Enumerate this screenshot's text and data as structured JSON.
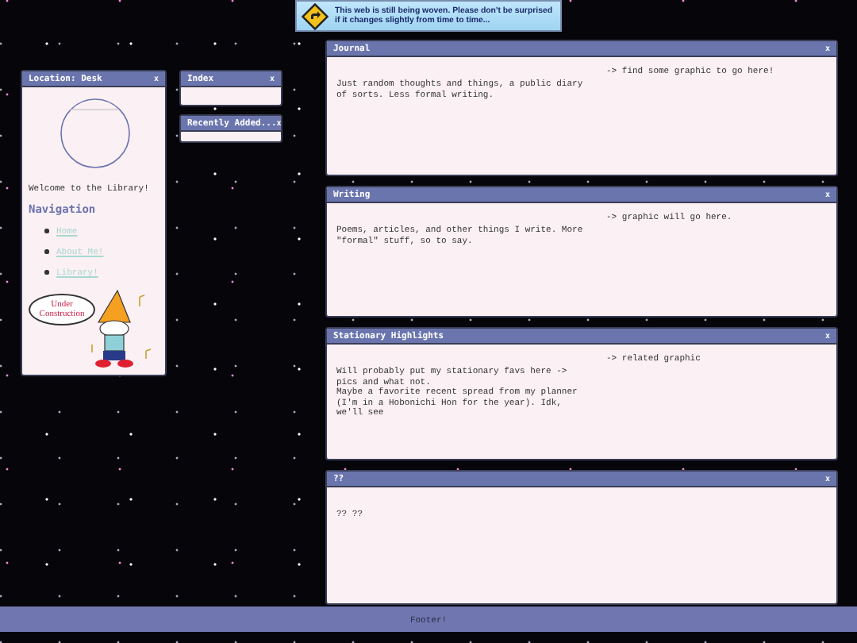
{
  "banner": {
    "text": "This web is still being woven.  Please don't be surprised if it changes slightly from time to time..."
  },
  "sidebar": {
    "title": "Location: Desk",
    "close": "x",
    "welcome": "Welcome to the Library!",
    "nav_heading": "Navigation",
    "nav_links": [
      {
        "label": "Home"
      },
      {
        "label": "About Me!"
      },
      {
        "label": "Library!"
      }
    ],
    "construction_sign": "Under Construction"
  },
  "side_windows": [
    {
      "title": "Index",
      "close": "x"
    },
    {
      "title": "Recently Added...",
      "close": "x"
    }
  ],
  "windows": [
    {
      "title": "Journal",
      "close": "x",
      "description": "Just random thoughts and things, a public diary of sorts. Less formal writing.",
      "note": "-> find some graphic to go here!"
    },
    {
      "title": "Writing",
      "close": "x",
      "description": "Poems, articles, and other things I write. More \"formal\" stuff, so to say.",
      "note": "-> graphic will go here."
    },
    {
      "title": "Stationary Highlights",
      "close": "x",
      "description": "Will probably put my stationary favs here -> pics and what not.\nMaybe a favorite recent spread from my planner (I'm in a Hobonichi Hon for the year). Idk, we'll see",
      "note": "-> related graphic"
    },
    {
      "title": "??",
      "close": "x",
      "description": "?? ??"
    }
  ],
  "footer": {
    "text": "Footer!"
  }
}
